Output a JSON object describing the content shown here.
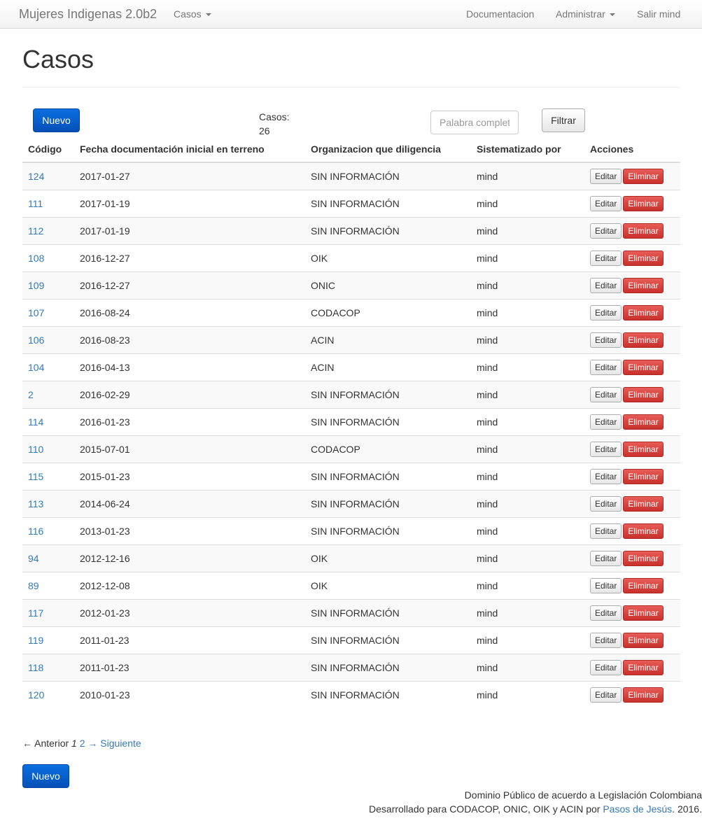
{
  "navbar": {
    "brand": "Mujeres Indigenas 2.0b2",
    "cases_menu": "Casos",
    "documentation": "Documentacion",
    "admin_menu": "Administrar",
    "logout": "Salir mind"
  },
  "page": {
    "title": "Casos",
    "new_button": "Nuevo",
    "count_label": "Casos:",
    "count_value": "26",
    "filter_placeholder": "Palabra completa",
    "filter_button": "Filtrar"
  },
  "table": {
    "headers": {
      "code": "Código",
      "date": "Fecha documentación inicial en terreno",
      "organization": "Organizacion que diligencia",
      "systematized_by": "Sistematizado por",
      "actions": "Acciones"
    },
    "edit_label": "Editar",
    "delete_label": "Eliminar",
    "rows": [
      {
        "code": "124",
        "date": "2017-01-27",
        "org": "SIN INFORMACIÓN",
        "user": "mind"
      },
      {
        "code": "111",
        "date": "2017-01-19",
        "org": "SIN INFORMACIÓN",
        "user": "mind"
      },
      {
        "code": "112",
        "date": "2017-01-19",
        "org": "SIN INFORMACIÓN",
        "user": "mind"
      },
      {
        "code": "108",
        "date": "2016-12-27",
        "org": "OIK",
        "user": "mind"
      },
      {
        "code": "109",
        "date": "2016-12-27",
        "org": "ONIC",
        "user": "mind"
      },
      {
        "code": "107",
        "date": "2016-08-24",
        "org": "CODACOP",
        "user": "mind"
      },
      {
        "code": "106",
        "date": "2016-08-23",
        "org": "ACIN",
        "user": "mind"
      },
      {
        "code": "104",
        "date": "2016-04-13",
        "org": "ACIN",
        "user": "mind"
      },
      {
        "code": "2",
        "date": "2016-02-29",
        "org": "SIN INFORMACIÓN",
        "user": "mind"
      },
      {
        "code": "114",
        "date": "2016-01-23",
        "org": "SIN INFORMACIÓN",
        "user": "mind"
      },
      {
        "code": "110",
        "date": "2015-07-01",
        "org": "CODACOP",
        "user": "mind"
      },
      {
        "code": "115",
        "date": "2015-01-23",
        "org": "SIN INFORMACIÓN",
        "user": "mind"
      },
      {
        "code": "113",
        "date": "2014-06-24",
        "org": "SIN INFORMACIÓN",
        "user": "mind"
      },
      {
        "code": "116",
        "date": "2013-01-23",
        "org": "SIN INFORMACIÓN",
        "user": "mind"
      },
      {
        "code": "94",
        "date": "2012-12-16",
        "org": "OIK",
        "user": "mind"
      },
      {
        "code": "89",
        "date": "2012-12-08",
        "org": "OIK",
        "user": "mind"
      },
      {
        "code": "117",
        "date": "2012-01-23",
        "org": "SIN INFORMACIÓN",
        "user": "mind"
      },
      {
        "code": "119",
        "date": "2011-01-23",
        "org": "SIN INFORMACIÓN",
        "user": "mind"
      },
      {
        "code": "118",
        "date": "2011-01-23",
        "org": "SIN INFORMACIÓN",
        "user": "mind"
      },
      {
        "code": "120",
        "date": "2010-01-23",
        "org": "SIN INFORMACIÓN",
        "user": "mind"
      }
    ]
  },
  "pagination": {
    "previous": "← Anterior",
    "current": "1",
    "next_page": "2",
    "next": "→ Siguiente"
  },
  "footer": {
    "line1": "Dominio Público de acuerdo a Legislación Colombiana",
    "line2_prefix": "Desarrollado para CODACOP, ONIC, OIK y ACIN por",
    "author_link": "Pasos de Jesús",
    "line2_suffix": ". 2016."
  }
}
